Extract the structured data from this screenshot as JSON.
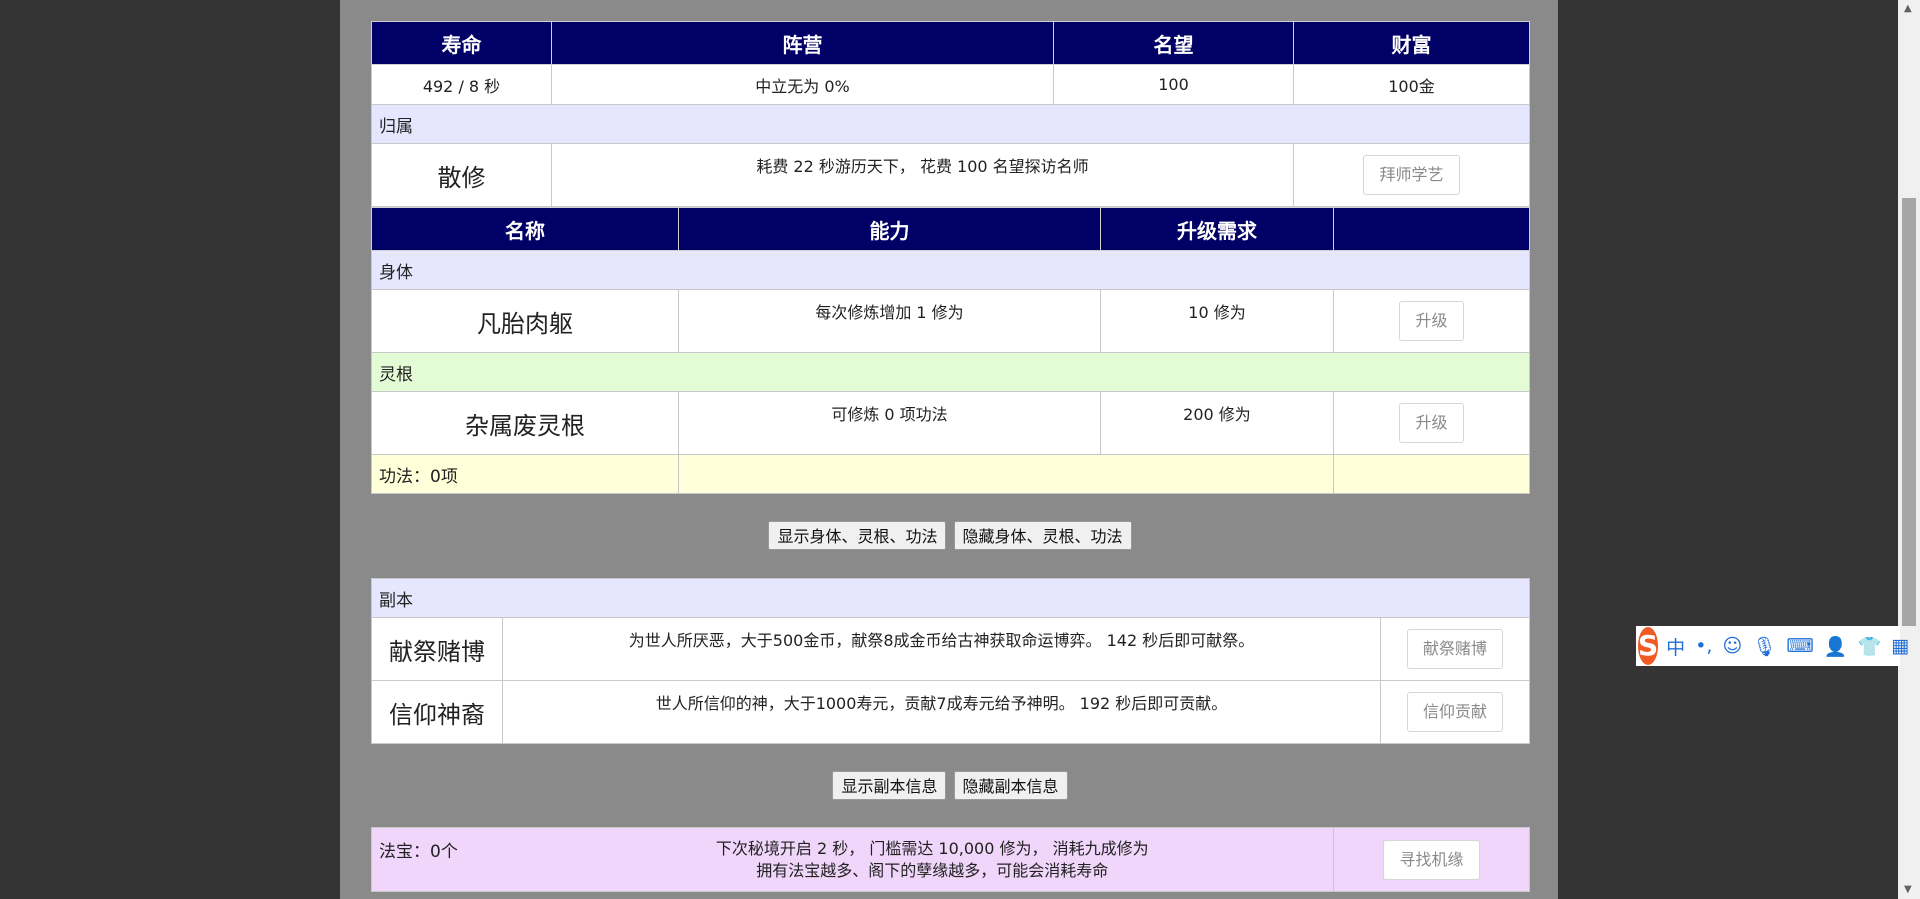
{
  "stats": {
    "headers": [
      "寿命",
      "阵营",
      "名望",
      "财富"
    ],
    "values": [
      "492 / 8 秒",
      "中立无为 0%",
      "100",
      "100金"
    ]
  },
  "affiliation": {
    "section": "归属",
    "name": "散修",
    "desc": "耗费 22 秒游历天下， 花费 100 名望探访名师",
    "button": "拜师学艺"
  },
  "abilities": {
    "headers": [
      "名称",
      "能力",
      "升级需求",
      ""
    ],
    "body_section": "身体",
    "body": {
      "name": "凡胎肉躯",
      "ability": "每次修炼增加 1 修为",
      "req": "10 修为",
      "button": "升级"
    },
    "root_section": "灵根",
    "root": {
      "name": "杂属废灵根",
      "ability": "可修炼 0 项功法",
      "req": "200 修为",
      "button": "升级"
    },
    "skills_label": "功法：0项"
  },
  "toggle1": {
    "show": "显示身体、灵根、功法",
    "hide": "隐藏身体、灵根、功法"
  },
  "dungeon": {
    "section": "副本",
    "rows": [
      {
        "name": "献祭赌博",
        "desc": "为世人所厌恶，大于500金币，献祭8成金币给古神获取命运博弈。 142 秒后即可献祭。",
        "button": "献祭赌博"
      },
      {
        "name": "信仰神裔",
        "desc": "世人所信仰的神，大于1000寿元，贡献7成寿元给予神明。 192 秒后即可贡献。",
        "button": "信仰贡献"
      }
    ]
  },
  "toggle2": {
    "show": "显示副本信息",
    "hide": "隐藏副本信息"
  },
  "treasure": {
    "label": "法宝：0个",
    "line1": "下次秘境开启 2 秒， 门槛需达 10,000 修为， 消耗九成修为",
    "line2": "拥有法宝越多、阁下的孽缘越多，可能会消耗寿命",
    "button": "寻找机缘"
  },
  "ime": {
    "logo": "S",
    "mode": "中",
    "punct": "•,"
  }
}
